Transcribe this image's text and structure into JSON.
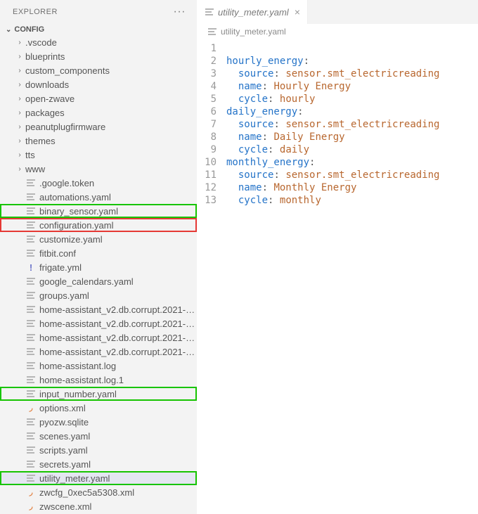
{
  "sidebar": {
    "title": "EXPLORER",
    "section": "CONFIG",
    "folders": [
      ".vscode",
      "blueprints",
      "custom_components",
      "downloads",
      "open-zwave",
      "packages",
      "peanutplugfirmware",
      "themes",
      "tts",
      "www"
    ],
    "files": [
      {
        "name": ".google.token",
        "icon": "lines"
      },
      {
        "name": "automations.yaml",
        "icon": "lines"
      },
      {
        "name": "binary_sensor.yaml",
        "icon": "lines",
        "hl": "g"
      },
      {
        "name": "configuration.yaml",
        "icon": "lines",
        "hl": "r"
      },
      {
        "name": "customize.yaml",
        "icon": "lines"
      },
      {
        "name": "fitbit.conf",
        "icon": "lines"
      },
      {
        "name": "frigate.yml",
        "icon": "exc"
      },
      {
        "name": "google_calendars.yaml",
        "icon": "lines"
      },
      {
        "name": "groups.yaml",
        "icon": "lines"
      },
      {
        "name": "home-assistant_v2.db.corrupt.2021-05-06T0...",
        "icon": "lines"
      },
      {
        "name": "home-assistant_v2.db.corrupt.2021-07-10T0...",
        "icon": "lines"
      },
      {
        "name": "home-assistant_v2.db.corrupt.2021-07-21T1...",
        "icon": "lines"
      },
      {
        "name": "home-assistant_v2.db.corrupt.2021-08-18T0...",
        "icon": "lines"
      },
      {
        "name": "home-assistant.log",
        "icon": "lines"
      },
      {
        "name": "home-assistant.log.1",
        "icon": "lines"
      },
      {
        "name": "input_number.yaml",
        "icon": "lines",
        "hl": "g"
      },
      {
        "name": "options.xml",
        "icon": "rss"
      },
      {
        "name": "pyozw.sqlite",
        "icon": "lines"
      },
      {
        "name": "scenes.yaml",
        "icon": "lines"
      },
      {
        "name": "scripts.yaml",
        "icon": "lines"
      },
      {
        "name": "secrets.yaml",
        "icon": "lines"
      },
      {
        "name": "utility_meter.yaml",
        "icon": "lines",
        "hl": "g",
        "sel": true
      },
      {
        "name": "zwcfg_0xec5a5308.xml",
        "icon": "rss"
      },
      {
        "name": "zwscene.xml",
        "icon": "rss"
      }
    ]
  },
  "tab": {
    "label": "utility_meter.yaml"
  },
  "breadcrumb": {
    "label": "utility_meter.yaml"
  },
  "code": {
    "lines": [
      {
        "n": 1,
        "segs": []
      },
      {
        "n": 2,
        "ind": 0,
        "k": "hourly_energy",
        "v": ""
      },
      {
        "n": 3,
        "ind": 1,
        "k": "source",
        "v": "sensor.smt_electricreading"
      },
      {
        "n": 4,
        "ind": 1,
        "k": "name",
        "v": "Hourly Energy"
      },
      {
        "n": 5,
        "ind": 1,
        "k": "cycle",
        "v": "hourly"
      },
      {
        "n": 6,
        "ind": 0,
        "k": "daily_energy",
        "v": ""
      },
      {
        "n": 7,
        "ind": 1,
        "k": "source",
        "v": "sensor.smt_electricreading"
      },
      {
        "n": 8,
        "ind": 1,
        "k": "name",
        "v": "Daily Energy"
      },
      {
        "n": 9,
        "ind": 1,
        "k": "cycle",
        "v": "daily"
      },
      {
        "n": 10,
        "ind": 0,
        "k": "monthly_energy",
        "v": ""
      },
      {
        "n": 11,
        "ind": 1,
        "k": "source",
        "v": "sensor.smt_electricreading"
      },
      {
        "n": 12,
        "ind": 1,
        "k": "name",
        "v": "Monthly Energy"
      },
      {
        "n": 13,
        "ind": 1,
        "k": "cycle",
        "v": "monthly"
      }
    ]
  }
}
